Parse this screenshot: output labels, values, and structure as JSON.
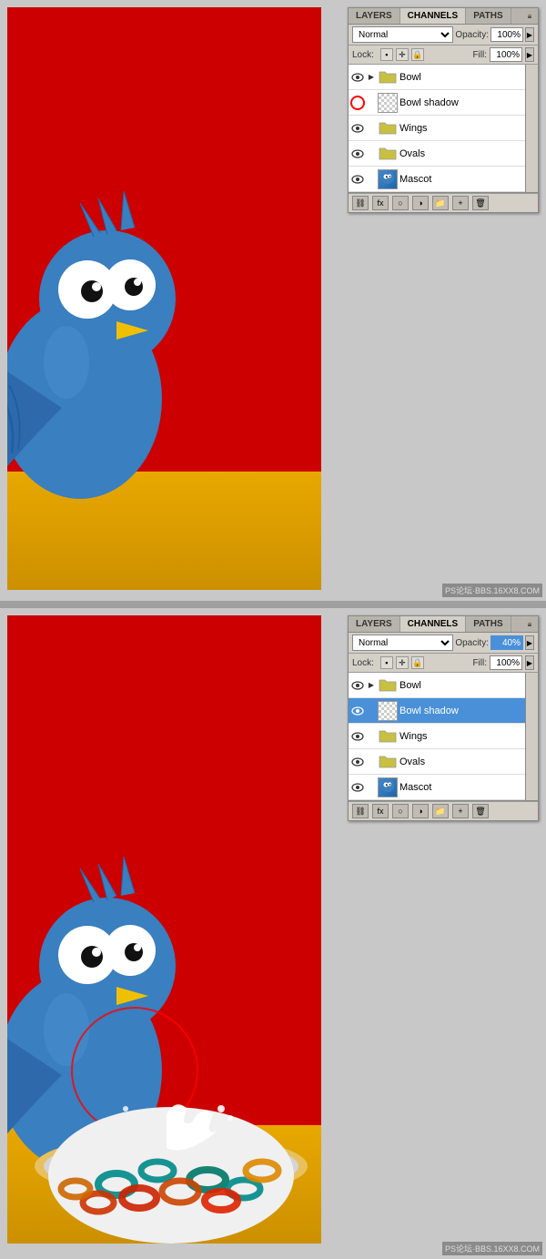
{
  "panel1": {
    "tabs": [
      "LAYERS",
      "CHANNELS",
      "PATHS"
    ],
    "active_tab": "LAYERS",
    "blend_mode": "Normal",
    "opacity_label": "Opacity:",
    "opacity_value": "100%",
    "lock_label": "Lock:",
    "fill_label": "Fill:",
    "fill_value": "100%",
    "layers": [
      {
        "name": "Bowl",
        "type": "folder",
        "visible": true,
        "has_arrow": true
      },
      {
        "name": "Bowl shadow",
        "type": "layer",
        "visible": true,
        "selected": false,
        "has_thumb": true,
        "thumb_type": "checker"
      },
      {
        "name": "Wings",
        "type": "folder",
        "visible": true,
        "has_arrow": false
      },
      {
        "name": "Ovals",
        "type": "folder",
        "visible": true,
        "has_arrow": false
      },
      {
        "name": "Mascot",
        "type": "layer",
        "visible": true,
        "has_thumb": true,
        "thumb_type": "bird"
      }
    ]
  },
  "panel2": {
    "tabs": [
      "LAYERS",
      "CHANNELS",
      "PATHS"
    ],
    "active_tab": "LAYERS",
    "blend_mode": "Normal",
    "opacity_label": "Opacity:",
    "opacity_value": "40%",
    "lock_label": "Lock:",
    "fill_label": "Fill:",
    "fill_value": "100%",
    "layers": [
      {
        "name": "Bowl",
        "type": "folder",
        "visible": true,
        "has_arrow": true
      },
      {
        "name": "Bowl shadow",
        "type": "layer",
        "visible": true,
        "selected": true,
        "has_thumb": true,
        "thumb_type": "checker"
      },
      {
        "name": "Wings",
        "type": "folder",
        "visible": true,
        "has_arrow": false
      },
      {
        "name": "Ovals",
        "type": "folder",
        "visible": true,
        "has_arrow": false
      },
      {
        "name": "Mascot",
        "type": "layer",
        "visible": true,
        "has_thumb": true,
        "thumb_type": "bird"
      }
    ]
  },
  "watermark": "PS论坛·BBS.16XX8.COM"
}
